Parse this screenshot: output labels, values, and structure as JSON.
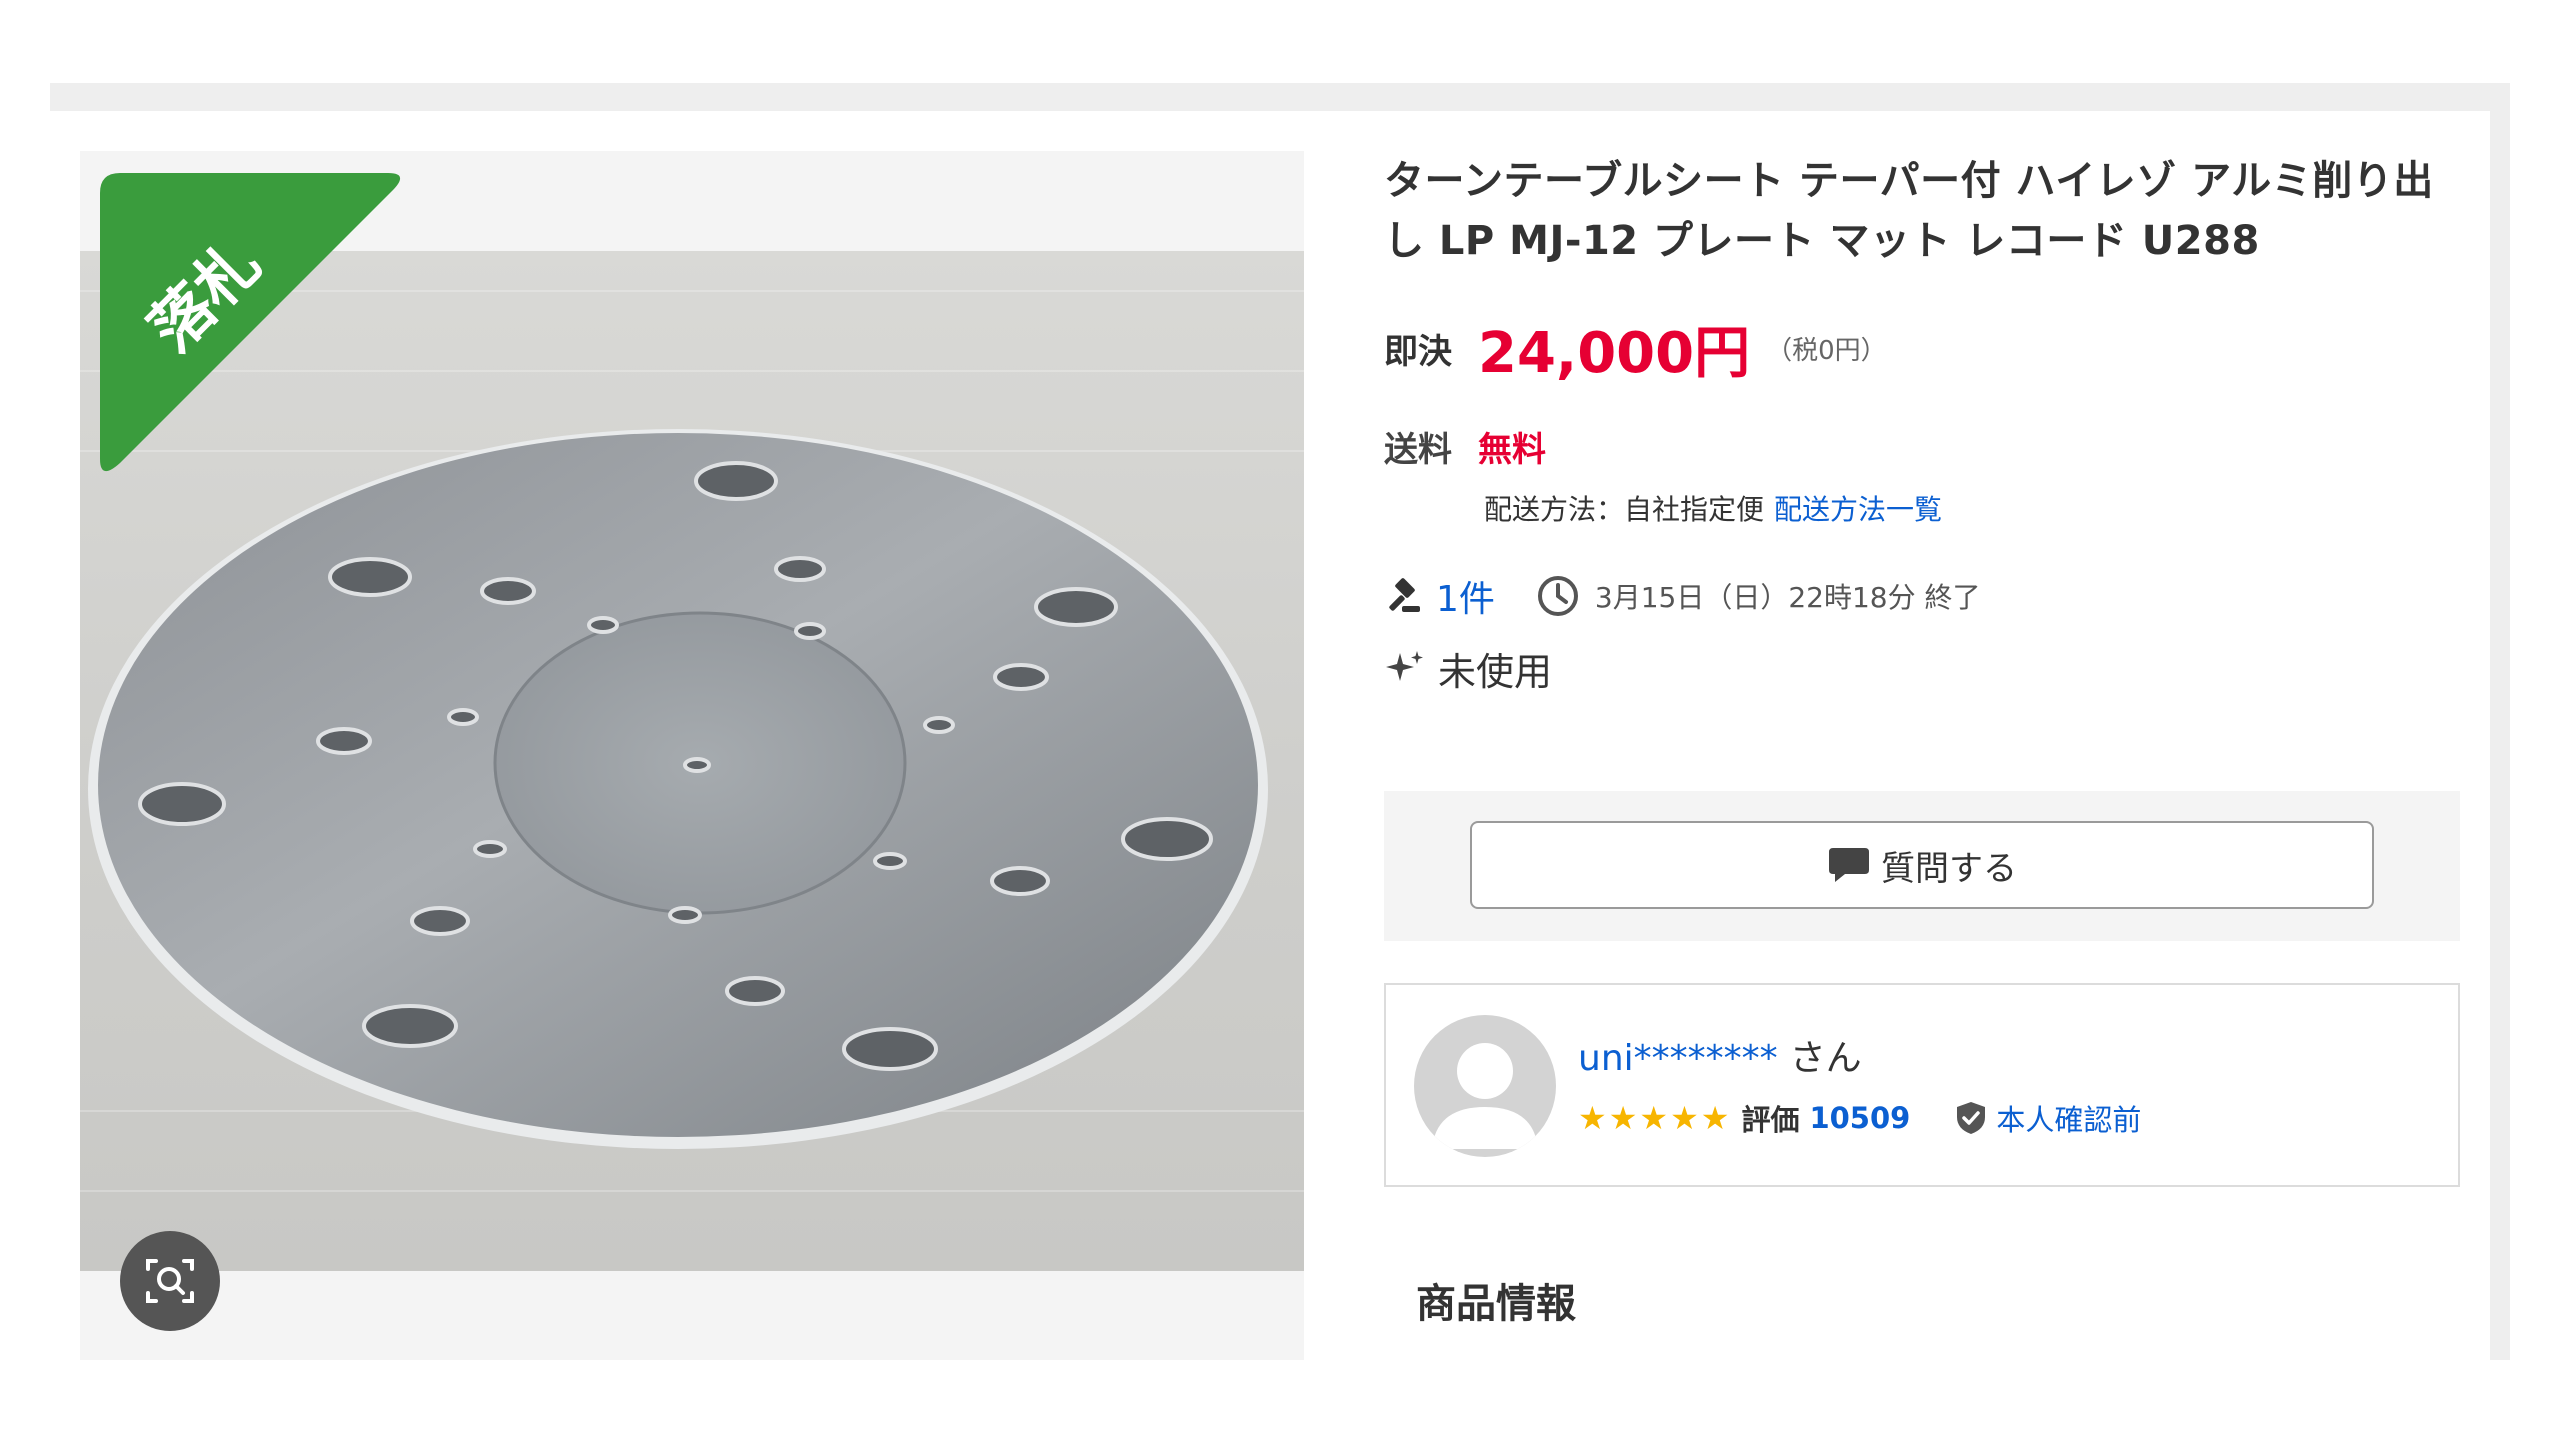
{
  "item": {
    "title": "ターンテーブルシート テーパー付 ハイレゾ アルミ削り出し LP MJ-12 プレート マット レコード U288",
    "sold_badge": "落札"
  },
  "price": {
    "label": "即決",
    "value": "24,000円",
    "tax_note": "（税0円）"
  },
  "shipping": {
    "label": "送料",
    "value": "無料",
    "method_text": "配送方法：自社指定便",
    "method_link": "配送方法一覧"
  },
  "auction": {
    "bid_count": "1件",
    "end_time": "3月15日（日）22時18分 終了",
    "condition": "未使用"
  },
  "question": {
    "button_label": "質問する"
  },
  "seller": {
    "name": "uni********",
    "suffix": "さん",
    "stars": "★★★★★",
    "rating_label": "評価",
    "rating_value": "10509",
    "verification": "本人確認前"
  },
  "sections": {
    "product_info": "商品情報"
  },
  "icons": {
    "zoom": "zoom-search-icon",
    "auction": "gavel-icon",
    "clock": "clock-icon",
    "condition": "sparkle-icon",
    "chat": "chat-bubble-icon",
    "shield": "shield-check-icon"
  },
  "colors": {
    "price_red": "#e60033",
    "link_blue": "#0b5fd1",
    "sold_green": "#3a9c3d",
    "star_yellow": "#f7b500"
  }
}
